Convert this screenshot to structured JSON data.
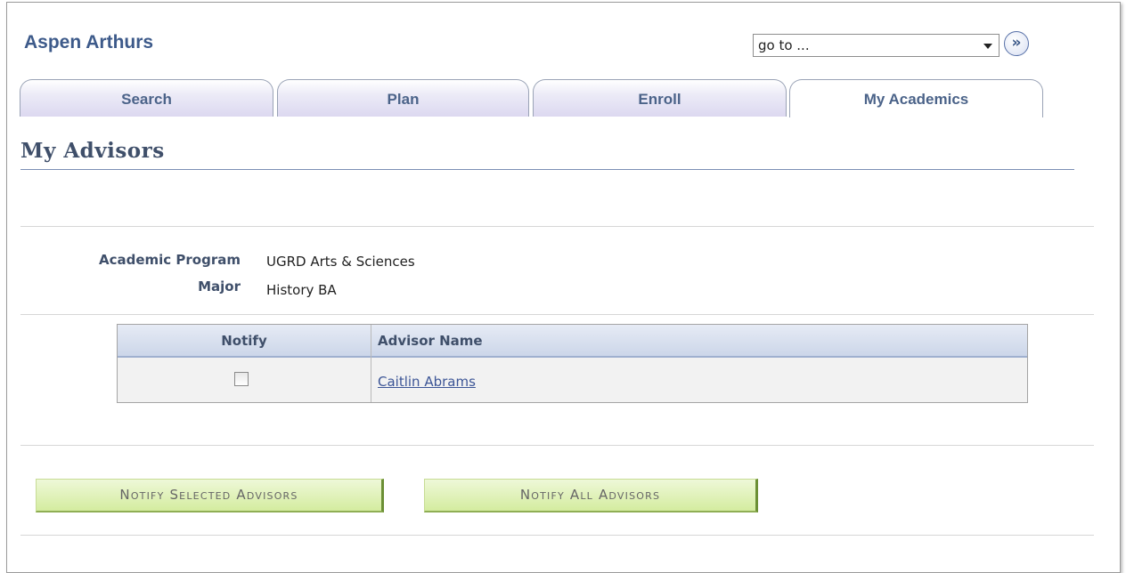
{
  "header": {
    "student_name": "Aspen Arthurs",
    "goto_value": "go to ...",
    "goto_button_glyph": "»"
  },
  "tabs": [
    {
      "label": "Search",
      "active": false
    },
    {
      "label": "Plan",
      "active": false
    },
    {
      "label": "Enroll",
      "active": false
    },
    {
      "label": "My Academics",
      "active": true
    }
  ],
  "page": {
    "title": "My Advisors"
  },
  "program_info": {
    "academic_program_label": "Academic Program",
    "academic_program_value": "UGRD Arts & Sciences",
    "major_label": "Major",
    "major_value": "History BA"
  },
  "advisors_grid": {
    "columns": [
      "Notify",
      "Advisor Name"
    ],
    "rows": [
      {
        "notify_checked": false,
        "advisor_name": "Caitlin Abrams"
      }
    ]
  },
  "actions": {
    "notify_selected_label": "Notify Selected Advisors",
    "notify_all_label": "Notify All Advisors"
  },
  "colors": {
    "header_blue": "#3d5a8a",
    "label_navy": "#3f4f6a",
    "link_blue": "#3c5596",
    "button_green": "#d4ec9f",
    "tab_lavender": "#dcd8f0"
  }
}
